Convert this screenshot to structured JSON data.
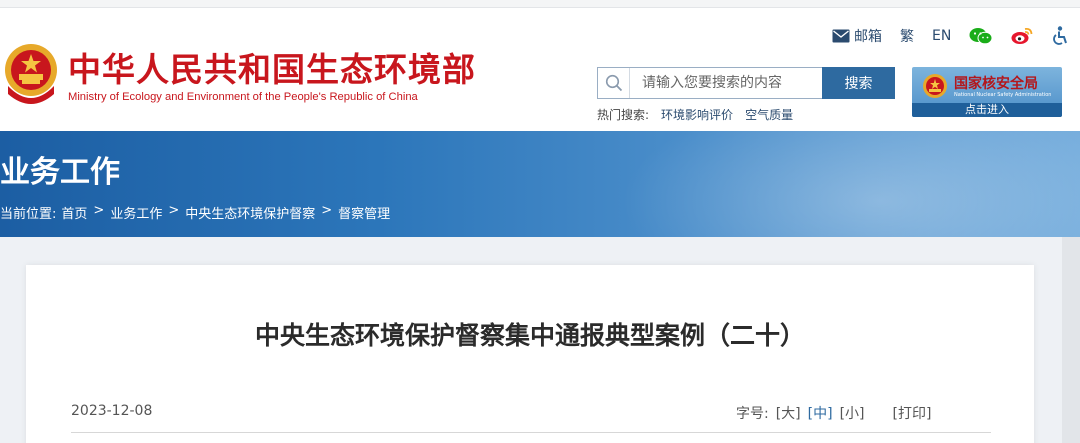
{
  "header": {
    "title_cn": "中华人民共和国生态环境部",
    "title_en": "Ministry of Ecology and Environment of the People's Republic of China",
    "links": {
      "mail": "邮箱",
      "traditional": "繁",
      "english": "EN"
    },
    "search": {
      "placeholder": "请输入您要搜索的内容",
      "button": "搜索"
    },
    "hot_search": {
      "label": "热门搜索:",
      "items": [
        "环境影响评价",
        "空气质量"
      ]
    },
    "nnsa": {
      "name": "国家核安全局",
      "en": "National Nuclear Safety Administration",
      "enter": "点击进入"
    }
  },
  "banner": {
    "title": "业务工作",
    "breadcrumb_label": "当前位置:",
    "breadcrumb": [
      "首页",
      "业务工作",
      "中央生态环境保护督察",
      "督察管理"
    ],
    "separator": ">"
  },
  "article": {
    "title": "中央生态环境保护督察集中通报典型案例（二十）",
    "date": "2023-12-08",
    "font_size_label": "字号:",
    "font_sizes": [
      "[大]",
      "[中]",
      "[小]"
    ],
    "print": "[打印]"
  },
  "colors": {
    "brand_red": "#c8161d",
    "link_blue": "#2e6aa0",
    "banner_blue": "#2c76ba"
  }
}
